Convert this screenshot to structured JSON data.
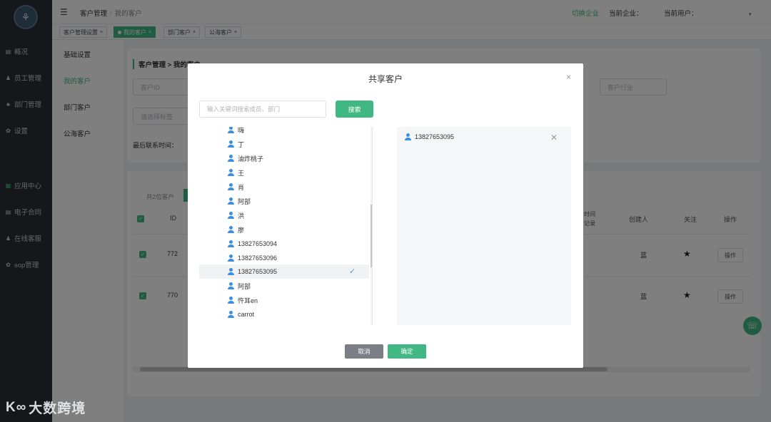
{
  "app": {
    "logo_glyph": "⚘",
    "watermark": "大数跨境",
    "watermark_mark": "K∞"
  },
  "sidebar": {
    "items": [
      {
        "label": "概况",
        "icon": "monitor-icon",
        "glyph": "▤"
      },
      {
        "label": "员工管理",
        "icon": "person-icon",
        "glyph": "♟"
      },
      {
        "label": "部门管理",
        "icon": "org-icon",
        "glyph": "♣"
      },
      {
        "label": "设置",
        "icon": "gear-icon",
        "glyph": "✿"
      },
      {
        "label": "应用中心",
        "icon": "apps-icon",
        "glyph": "▦"
      },
      {
        "label": "电子合同",
        "icon": "contract-icon",
        "glyph": "▤"
      },
      {
        "label": "在线客服",
        "icon": "service-icon",
        "glyph": "♟"
      },
      {
        "label": "sop管理",
        "icon": "sop-icon",
        "glyph": "✿"
      }
    ]
  },
  "header": {
    "menu_toggle": "☰",
    "crumb_root": "客户管理",
    "crumb_sep": "/",
    "crumb_current": "我的客户",
    "switch_company": "切换企业",
    "current_company": "当前企业：",
    "current_user": "当前用户：",
    "caret": "▾"
  },
  "tabs": [
    {
      "label": "客户管理设置",
      "active": false
    },
    {
      "label": "我的客户",
      "active": true
    },
    {
      "label": "部门客户",
      "active": false
    },
    {
      "label": "公海客户",
      "active": false
    }
  ],
  "tab_close": "×",
  "submenu": {
    "items": [
      "基础设置",
      "我的客户",
      "部门客户",
      "公海客户"
    ]
  },
  "main": {
    "card_title": "客户管理 > 我的客户",
    "customer_id_placeholder": "客户ID",
    "industry_placeholder": "客户行业",
    "tags_placeholder": "请选择标签",
    "last_contact_label": "最后联系时间：",
    "summary": "共2位客户",
    "columns": [
      "ID",
      "创建人",
      "关注",
      "操作"
    ],
    "col_partial": "时间\n记录",
    "rows": [
      {
        "id": "772",
        "creator": "蓝",
        "op": "操作"
      },
      {
        "id": "770",
        "creator": "蓝",
        "op": "操作"
      }
    ],
    "star": "★",
    "check": "✓"
  },
  "support_glyph": "☏",
  "modal": {
    "title": "共享客户",
    "close": "×",
    "search_placeholder": "输入关键词搜索成员、部门",
    "search_button": "搜索",
    "members": [
      {
        "name": "嗨",
        "selected": false
      },
      {
        "name": "丁",
        "selected": false
      },
      {
        "name": "油炸桃子",
        "selected": false
      },
      {
        "name": "王",
        "selected": false
      },
      {
        "name": "肖",
        "selected": false
      },
      {
        "name": "阿部",
        "selected": false
      },
      {
        "name": "洪",
        "selected": false
      },
      {
        "name": "廖",
        "selected": false
      },
      {
        "name": "13827653094",
        "selected": false
      },
      {
        "name": "13827653096",
        "selected": false
      },
      {
        "name": "13827653095",
        "selected": true
      },
      {
        "name": "阿部",
        "selected": false
      },
      {
        "name": "忤耳en",
        "selected": false
      },
      {
        "name": "carrot",
        "selected": false
      }
    ],
    "check_glyph": "✓",
    "chosen": [
      {
        "name": "13827653095"
      }
    ],
    "remove_glyph": "✕",
    "cancel_button": "取消",
    "confirm_button": "确定"
  },
  "colors": {
    "accent": "#41b883",
    "sidebar_bg": "#2b2f36",
    "cancel_bg": "#7b7f85",
    "user_icon": "#3a8ee6"
  }
}
